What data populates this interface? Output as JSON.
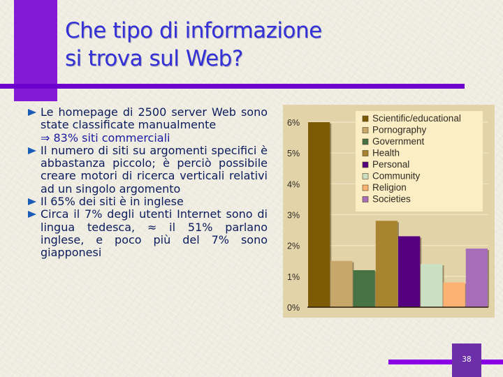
{
  "slide": {
    "title_line1": "Che tipo di informazione",
    "title_line2": "si trova sul Web?",
    "slide_number": "38",
    "accent_color": "#8419d6",
    "title_color": "#3431d6"
  },
  "bullets": [
    {
      "text": "Le homepage di 2500 server Web sono state classificate manualmente",
      "sub": "⇒ 83% siti commerciali"
    },
    {
      "text": "Il numero di siti su argomenti specifici è abbastanza piccolo; è perciò possibile creare motori di ricerca verticali relativi ad un singolo argomento"
    },
    {
      "text": "Il 65% dei siti è in inglese"
    },
    {
      "text": "Circa il 7% degli utenti Internet sono di lingua tedesca, ≈ il 51% parlano inglese, e poco più del 7% sono giapponesi"
    }
  ],
  "chart_data": {
    "type": "bar",
    "title": "",
    "xlabel": "",
    "ylabel": "",
    "categories": [
      "Scientific/educational",
      "Pornography",
      "Government",
      "Health",
      "Personal",
      "Community",
      "Religion",
      "Societies"
    ],
    "values": [
      6.0,
      1.5,
      1.2,
      2.8,
      2.3,
      1.4,
      0.8,
      1.9
    ],
    "colors": [
      "#7d5a05",
      "#c8a86a",
      "#477244",
      "#a98430",
      "#54007f",
      "#cbe0c3",
      "#fdb274",
      "#a66db9"
    ],
    "ylim": [
      0,
      6
    ],
    "yticks": [
      "0%",
      "1%",
      "2%",
      "3%",
      "4%",
      "5%",
      "6%"
    ],
    "grid": true,
    "legend": {
      "placement": "top-right",
      "entries": [
        "Scientific/educational",
        "Pornography",
        "Government",
        "Health",
        "Personal",
        "Community",
        "Religion",
        "Societies"
      ]
    }
  }
}
